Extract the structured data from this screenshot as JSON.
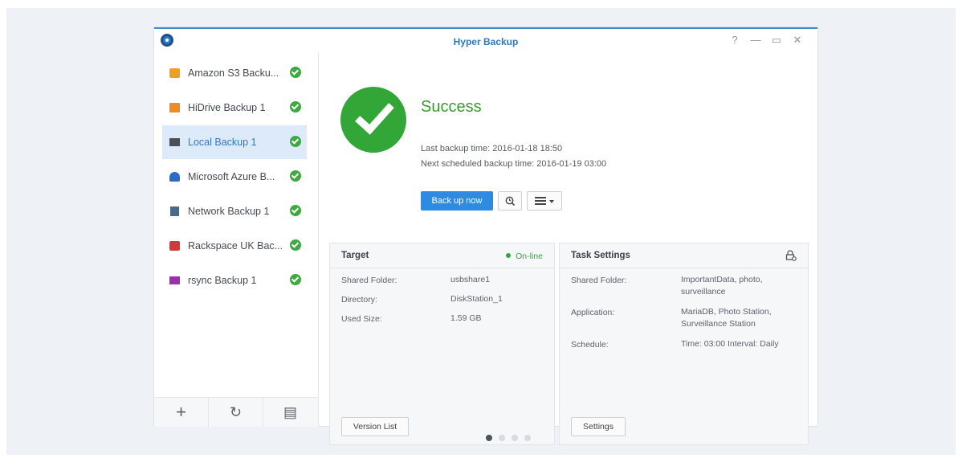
{
  "window": {
    "title": "Hyper Backup",
    "controls": [
      "?",
      "—",
      "▭",
      "✕"
    ]
  },
  "sidebar": {
    "items": [
      {
        "label": "Amazon S3 Backu...",
        "icon": "amazon-s3-icon",
        "color": "#f0a020",
        "status": "success"
      },
      {
        "label": "HiDrive Backup 1",
        "icon": "hidrive-icon",
        "color": "#f08a24",
        "status": "success"
      },
      {
        "label": "Local Backup 1",
        "icon": "local-drive-icon",
        "color": "#4a4f55",
        "status": "success",
        "active": true
      },
      {
        "label": "Microsoft Azure B...",
        "icon": "azure-cloud-icon",
        "color": "#2b6cc4",
        "status": "success"
      },
      {
        "label": "Network Backup 1",
        "icon": "network-server-icon",
        "color": "#4a6a8a",
        "status": "success"
      },
      {
        "label": "Rackspace UK Bac...",
        "icon": "rackspace-icon",
        "color": "#d03a3a",
        "status": "success"
      },
      {
        "label": "rsync Backup 1",
        "icon": "rsync-folder-icon",
        "color": "#9b2fae",
        "status": "success"
      }
    ],
    "footer": [
      {
        "glyph": "+",
        "icon": "add-icon"
      },
      {
        "glyph": "↻",
        "icon": "restore-history-icon"
      },
      {
        "glyph": "▤",
        "icon": "log-icon"
      }
    ]
  },
  "status": {
    "title": "Success",
    "last_backup": "Last backup time: 2016-01-18 18:50",
    "next_backup": "Next scheduled backup time: 2016-01-19 03:00",
    "back_up_now": "Back up now",
    "color": "#32a637"
  },
  "target": {
    "title": "Target",
    "online": "On-line",
    "rows": [
      {
        "label": "Shared Folder:",
        "value": "usbshare1"
      },
      {
        "label": "Directory:",
        "value": "DiskStation_1"
      },
      {
        "label": "Used Size:",
        "value": "1.59 GB"
      }
    ],
    "button": "Version List"
  },
  "task": {
    "title": "Task Settings",
    "rows": [
      {
        "label": "Shared Folder:",
        "value": "ImportantData, photo,",
        "value2": "surveillance"
      },
      {
        "label": "Application:",
        "value": "MariaDB, Photo Station,",
        "value2": "Surveillance Station"
      },
      {
        "label": "Schedule:",
        "value": "Time: 03:00 Interval: Daily"
      }
    ],
    "button": "Settings"
  },
  "pager": {
    "total": 4,
    "current": 1
  }
}
